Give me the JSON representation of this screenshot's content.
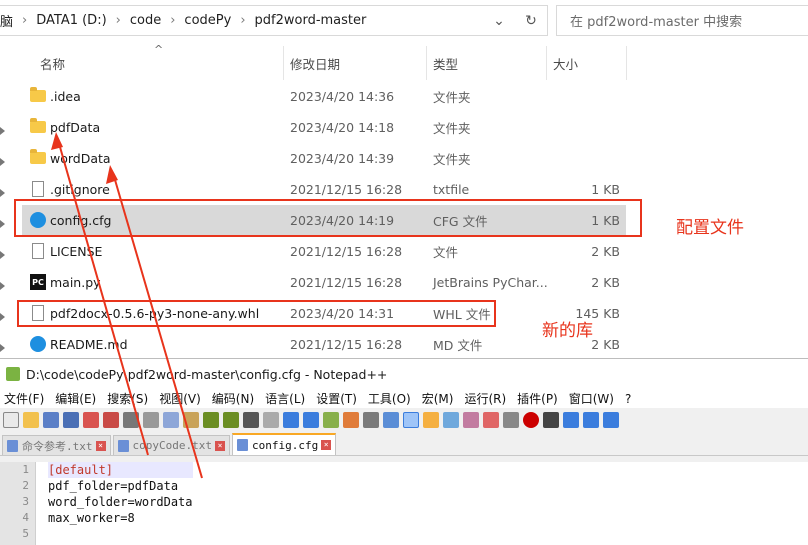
{
  "explorer": {
    "breadcrumb": [
      "脑",
      "DATA1 (D:)",
      "code",
      "codePy",
      "pdf2word-master"
    ],
    "search_placeholder": "在 pdf2word-master 中搜索",
    "columns": {
      "name": "名称",
      "date": "修改日期",
      "type": "类型",
      "size": "大小"
    },
    "rows": [
      {
        "name": ".idea",
        "date": "2023/4/20 14:36",
        "type": "文件夹",
        "size": "",
        "icon": "folder-icon"
      },
      {
        "name": "pdfData",
        "date": "2023/4/20 14:18",
        "type": "文件夹",
        "size": "",
        "icon": "folder-icon"
      },
      {
        "name": "wordData",
        "date": "2023/4/20 14:39",
        "type": "文件夹",
        "size": "",
        "icon": "folder-icon"
      },
      {
        "name": ".gitignore",
        "date": "2021/12/15 16:28",
        "type": "txtfile",
        "size": "1 KB",
        "icon": "file-icon"
      },
      {
        "name": "config.cfg",
        "date": "2023/4/20 14:19",
        "type": "CFG 文件",
        "size": "1 KB",
        "icon": "gear-file-icon",
        "selected": true
      },
      {
        "name": "LICENSE",
        "date": "2021/12/15 16:28",
        "type": "文件",
        "size": "2 KB",
        "icon": "file-icon"
      },
      {
        "name": "main.py",
        "date": "2021/12/15 16:28",
        "type": "JetBrains PyChar...",
        "size": "2 KB",
        "icon": "pycharm-icon"
      },
      {
        "name": "pdf2docx-0.5.6-py3-none-any.whl",
        "date": "2023/4/20 14:31",
        "type": "WHL 文件",
        "size": "145 KB",
        "icon": "file-icon"
      },
      {
        "name": "README.md",
        "date": "2021/12/15 16:28",
        "type": "MD 文件",
        "size": "2 KB",
        "icon": "gear-file-icon"
      }
    ]
  },
  "annotations": {
    "config_label": "配置文件",
    "lib_label": "新的库"
  },
  "notepad": {
    "title": "D:\\code\\codePy\\pdf2word-master\\config.cfg - Notepad++",
    "menus": [
      "文件(F)",
      "编辑(E)",
      "搜索(S)",
      "视图(V)",
      "编码(N)",
      "语言(L)",
      "设置(T)",
      "工具(O)",
      "宏(M)",
      "运行(R)",
      "插件(P)",
      "窗口(W)",
      "?"
    ],
    "tabs": [
      {
        "label": "命令参考.txt",
        "active": false
      },
      {
        "label": "copyCode.txt",
        "active": false
      },
      {
        "label": "config.cfg",
        "active": true
      }
    ],
    "lines": [
      "[default]",
      "pdf_folder=pdfData",
      "word_folder=wordData",
      "max_worker=8",
      ""
    ],
    "line_numbers": [
      "1",
      "2",
      "3",
      "4",
      "5"
    ]
  },
  "colors": {
    "annotation": "#e8341c",
    "selected_row": "#d9d9d9",
    "folder": "#f7c948"
  }
}
